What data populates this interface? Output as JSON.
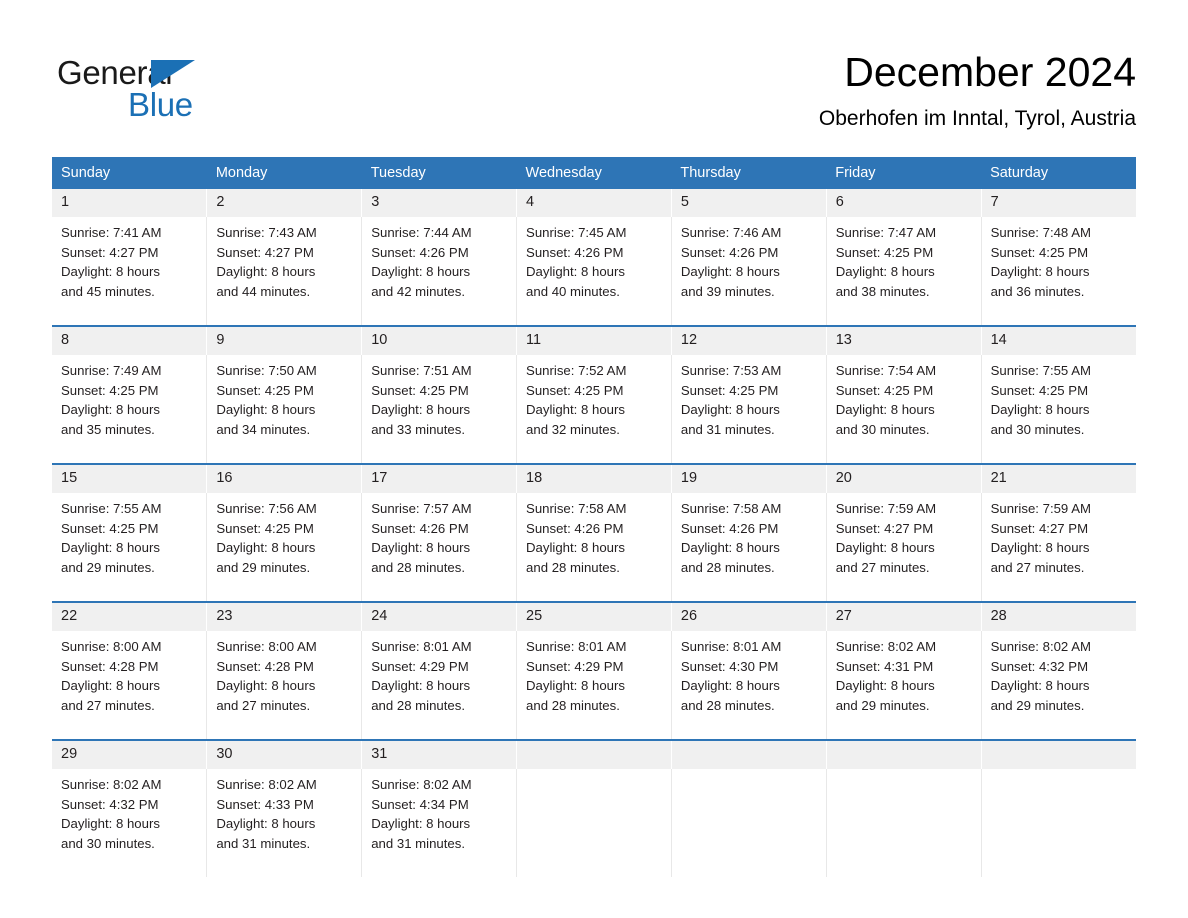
{
  "brand": {
    "name_part1": "General",
    "name_part2": "Blue",
    "triangle_icon": "triangle-icon",
    "accent_color": "#1b70b5"
  },
  "header": {
    "month_title": "December 2024",
    "location": "Oberhofen im Inntal, Tyrol, Austria"
  },
  "theme": {
    "header_blue": "#2e75b6",
    "daynum_band": "#f0f0f0",
    "text": "#231f20"
  },
  "calendar": {
    "weekday_headers": [
      "Sunday",
      "Monday",
      "Tuesday",
      "Wednesday",
      "Thursday",
      "Friday",
      "Saturday"
    ],
    "weeks": [
      {
        "days": [
          {
            "number": "1",
            "sunrise": "Sunrise: 7:41 AM",
            "sunset": "Sunset: 4:27 PM",
            "daylight_line1": "Daylight: 8 hours",
            "daylight_line2": "and 45 minutes."
          },
          {
            "number": "2",
            "sunrise": "Sunrise: 7:43 AM",
            "sunset": "Sunset: 4:27 PM",
            "daylight_line1": "Daylight: 8 hours",
            "daylight_line2": "and 44 minutes."
          },
          {
            "number": "3",
            "sunrise": "Sunrise: 7:44 AM",
            "sunset": "Sunset: 4:26 PM",
            "daylight_line1": "Daylight: 8 hours",
            "daylight_line2": "and 42 minutes."
          },
          {
            "number": "4",
            "sunrise": "Sunrise: 7:45 AM",
            "sunset": "Sunset: 4:26 PM",
            "daylight_line1": "Daylight: 8 hours",
            "daylight_line2": "and 40 minutes."
          },
          {
            "number": "5",
            "sunrise": "Sunrise: 7:46 AM",
            "sunset": "Sunset: 4:26 PM",
            "daylight_line1": "Daylight: 8 hours",
            "daylight_line2": "and 39 minutes."
          },
          {
            "number": "6",
            "sunrise": "Sunrise: 7:47 AM",
            "sunset": "Sunset: 4:25 PM",
            "daylight_line1": "Daylight: 8 hours",
            "daylight_line2": "and 38 minutes."
          },
          {
            "number": "7",
            "sunrise": "Sunrise: 7:48 AM",
            "sunset": "Sunset: 4:25 PM",
            "daylight_line1": "Daylight: 8 hours",
            "daylight_line2": "and 36 minutes."
          }
        ]
      },
      {
        "days": [
          {
            "number": "8",
            "sunrise": "Sunrise: 7:49 AM",
            "sunset": "Sunset: 4:25 PM",
            "daylight_line1": "Daylight: 8 hours",
            "daylight_line2": "and 35 minutes."
          },
          {
            "number": "9",
            "sunrise": "Sunrise: 7:50 AM",
            "sunset": "Sunset: 4:25 PM",
            "daylight_line1": "Daylight: 8 hours",
            "daylight_line2": "and 34 minutes."
          },
          {
            "number": "10",
            "sunrise": "Sunrise: 7:51 AM",
            "sunset": "Sunset: 4:25 PM",
            "daylight_line1": "Daylight: 8 hours",
            "daylight_line2": "and 33 minutes."
          },
          {
            "number": "11",
            "sunrise": "Sunrise: 7:52 AM",
            "sunset": "Sunset: 4:25 PM",
            "daylight_line1": "Daylight: 8 hours",
            "daylight_line2": "and 32 minutes."
          },
          {
            "number": "12",
            "sunrise": "Sunrise: 7:53 AM",
            "sunset": "Sunset: 4:25 PM",
            "daylight_line1": "Daylight: 8 hours",
            "daylight_line2": "and 31 minutes."
          },
          {
            "number": "13",
            "sunrise": "Sunrise: 7:54 AM",
            "sunset": "Sunset: 4:25 PM",
            "daylight_line1": "Daylight: 8 hours",
            "daylight_line2": "and 30 minutes."
          },
          {
            "number": "14",
            "sunrise": "Sunrise: 7:55 AM",
            "sunset": "Sunset: 4:25 PM",
            "daylight_line1": "Daylight: 8 hours",
            "daylight_line2": "and 30 minutes."
          }
        ]
      },
      {
        "days": [
          {
            "number": "15",
            "sunrise": "Sunrise: 7:55 AM",
            "sunset": "Sunset: 4:25 PM",
            "daylight_line1": "Daylight: 8 hours",
            "daylight_line2": "and 29 minutes."
          },
          {
            "number": "16",
            "sunrise": "Sunrise: 7:56 AM",
            "sunset": "Sunset: 4:25 PM",
            "daylight_line1": "Daylight: 8 hours",
            "daylight_line2": "and 29 minutes."
          },
          {
            "number": "17",
            "sunrise": "Sunrise: 7:57 AM",
            "sunset": "Sunset: 4:26 PM",
            "daylight_line1": "Daylight: 8 hours",
            "daylight_line2": "and 28 minutes."
          },
          {
            "number": "18",
            "sunrise": "Sunrise: 7:58 AM",
            "sunset": "Sunset: 4:26 PM",
            "daylight_line1": "Daylight: 8 hours",
            "daylight_line2": "and 28 minutes."
          },
          {
            "number": "19",
            "sunrise": "Sunrise: 7:58 AM",
            "sunset": "Sunset: 4:26 PM",
            "daylight_line1": "Daylight: 8 hours",
            "daylight_line2": "and 28 minutes."
          },
          {
            "number": "20",
            "sunrise": "Sunrise: 7:59 AM",
            "sunset": "Sunset: 4:27 PM",
            "daylight_line1": "Daylight: 8 hours",
            "daylight_line2": "and 27 minutes."
          },
          {
            "number": "21",
            "sunrise": "Sunrise: 7:59 AM",
            "sunset": "Sunset: 4:27 PM",
            "daylight_line1": "Daylight: 8 hours",
            "daylight_line2": "and 27 minutes."
          }
        ]
      },
      {
        "days": [
          {
            "number": "22",
            "sunrise": "Sunrise: 8:00 AM",
            "sunset": "Sunset: 4:28 PM",
            "daylight_line1": "Daylight: 8 hours",
            "daylight_line2": "and 27 minutes."
          },
          {
            "number": "23",
            "sunrise": "Sunrise: 8:00 AM",
            "sunset": "Sunset: 4:28 PM",
            "daylight_line1": "Daylight: 8 hours",
            "daylight_line2": "and 27 minutes."
          },
          {
            "number": "24",
            "sunrise": "Sunrise: 8:01 AM",
            "sunset": "Sunset: 4:29 PM",
            "daylight_line1": "Daylight: 8 hours",
            "daylight_line2": "and 28 minutes."
          },
          {
            "number": "25",
            "sunrise": "Sunrise: 8:01 AM",
            "sunset": "Sunset: 4:29 PM",
            "daylight_line1": "Daylight: 8 hours",
            "daylight_line2": "and 28 minutes."
          },
          {
            "number": "26",
            "sunrise": "Sunrise: 8:01 AM",
            "sunset": "Sunset: 4:30 PM",
            "daylight_line1": "Daylight: 8 hours",
            "daylight_line2": "and 28 minutes."
          },
          {
            "number": "27",
            "sunrise": "Sunrise: 8:02 AM",
            "sunset": "Sunset: 4:31 PM",
            "daylight_line1": "Daylight: 8 hours",
            "daylight_line2": "and 29 minutes."
          },
          {
            "number": "28",
            "sunrise": "Sunrise: 8:02 AM",
            "sunset": "Sunset: 4:32 PM",
            "daylight_line1": "Daylight: 8 hours",
            "daylight_line2": "and 29 minutes."
          }
        ]
      },
      {
        "days": [
          {
            "number": "29",
            "sunrise": "Sunrise: 8:02 AM",
            "sunset": "Sunset: 4:32 PM",
            "daylight_line1": "Daylight: 8 hours",
            "daylight_line2": "and 30 minutes."
          },
          {
            "number": "30",
            "sunrise": "Sunrise: 8:02 AM",
            "sunset": "Sunset: 4:33 PM",
            "daylight_line1": "Daylight: 8 hours",
            "daylight_line2": "and 31 minutes."
          },
          {
            "number": "31",
            "sunrise": "Sunrise: 8:02 AM",
            "sunset": "Sunset: 4:34 PM",
            "daylight_line1": "Daylight: 8 hours",
            "daylight_line2": "and 31 minutes."
          },
          {
            "number": "",
            "sunrise": "",
            "sunset": "",
            "daylight_line1": "",
            "daylight_line2": ""
          },
          {
            "number": "",
            "sunrise": "",
            "sunset": "",
            "daylight_line1": "",
            "daylight_line2": ""
          },
          {
            "number": "",
            "sunrise": "",
            "sunset": "",
            "daylight_line1": "",
            "daylight_line2": ""
          },
          {
            "number": "",
            "sunrise": "",
            "sunset": "",
            "daylight_line1": "",
            "daylight_line2": ""
          }
        ]
      }
    ]
  }
}
